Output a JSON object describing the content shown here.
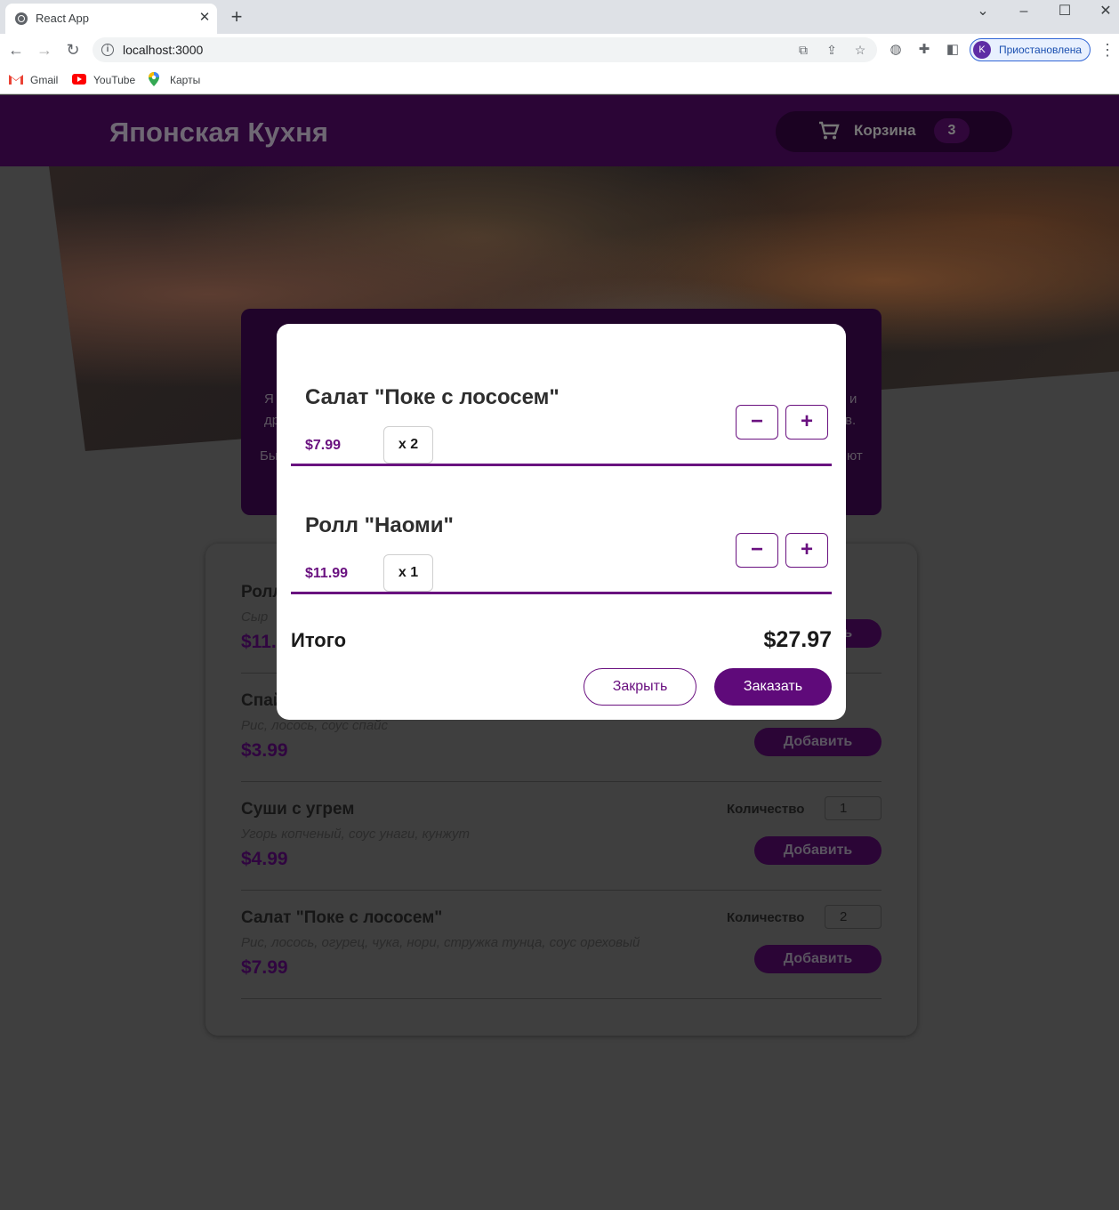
{
  "browser": {
    "tab_title": "React App",
    "url": "localhost:3000",
    "profile_initial": "K",
    "profile_label": "Приостановлена",
    "bookmarks": [
      {
        "label": "Gmail",
        "icon": "gmail-icon"
      },
      {
        "label": "YouTube",
        "icon": "youtube-icon"
      },
      {
        "label": "Карты",
        "icon": "maps-icon"
      }
    ]
  },
  "header": {
    "site_title": "Японская Кухня",
    "cart_label": "Корзина",
    "cart_count": "3"
  },
  "menu": {
    "items": [
      {
        "name": "Ролл \"Наоми\"",
        "name_visible": "Ролл",
        "desc": "Сыр",
        "price": "$11.",
        "qty_label": "",
        "qty": "",
        "add_label": "Добавить"
      },
      {
        "name": "Спайс",
        "name_visible": "Спай",
        "desc": "Рис, лосось, соус спайс",
        "price": "$3.99",
        "qty_label": "",
        "qty": "",
        "add_label": "Добавить"
      },
      {
        "name": "Суши с угрем",
        "name_visible": "Суши с угрем",
        "desc": "Угорь копченый, соус унаги, кунжут",
        "price": "$4.99",
        "qty_label": "Количество",
        "qty": "1",
        "add_label": "Добавить"
      },
      {
        "name": "Салат \"Поке с лососем\"",
        "name_visible": "Салат \"Поке с лососем\"",
        "desc": "Рис, лосось, огурец, чука, нори, стружка тунца, соус ореховый",
        "price": "$7.99",
        "qty_label": "Количество",
        "qty": "2",
        "add_label": "Добавить"
      }
    ]
  },
  "about": {
    "fragments": [
      "Я",
      "др",
      "Бы",
      "и",
      "в.",
      "ют"
    ]
  },
  "cart_modal": {
    "items": [
      {
        "name": "Салат \"Поке с лососем\"",
        "price": "$7.99",
        "qty": "x 2"
      },
      {
        "name": "Ролл \"Наоми\"",
        "price": "$11.99",
        "qty": "x 1"
      }
    ],
    "minus_symbol": "−",
    "plus_symbol": "+",
    "total_label": "Итого",
    "total_value": "$27.97",
    "close_label": "Закрыть",
    "order_label": "Заказать"
  },
  "colors": {
    "brand": "#5f0a7a",
    "overlay": "#3f3f3f"
  }
}
